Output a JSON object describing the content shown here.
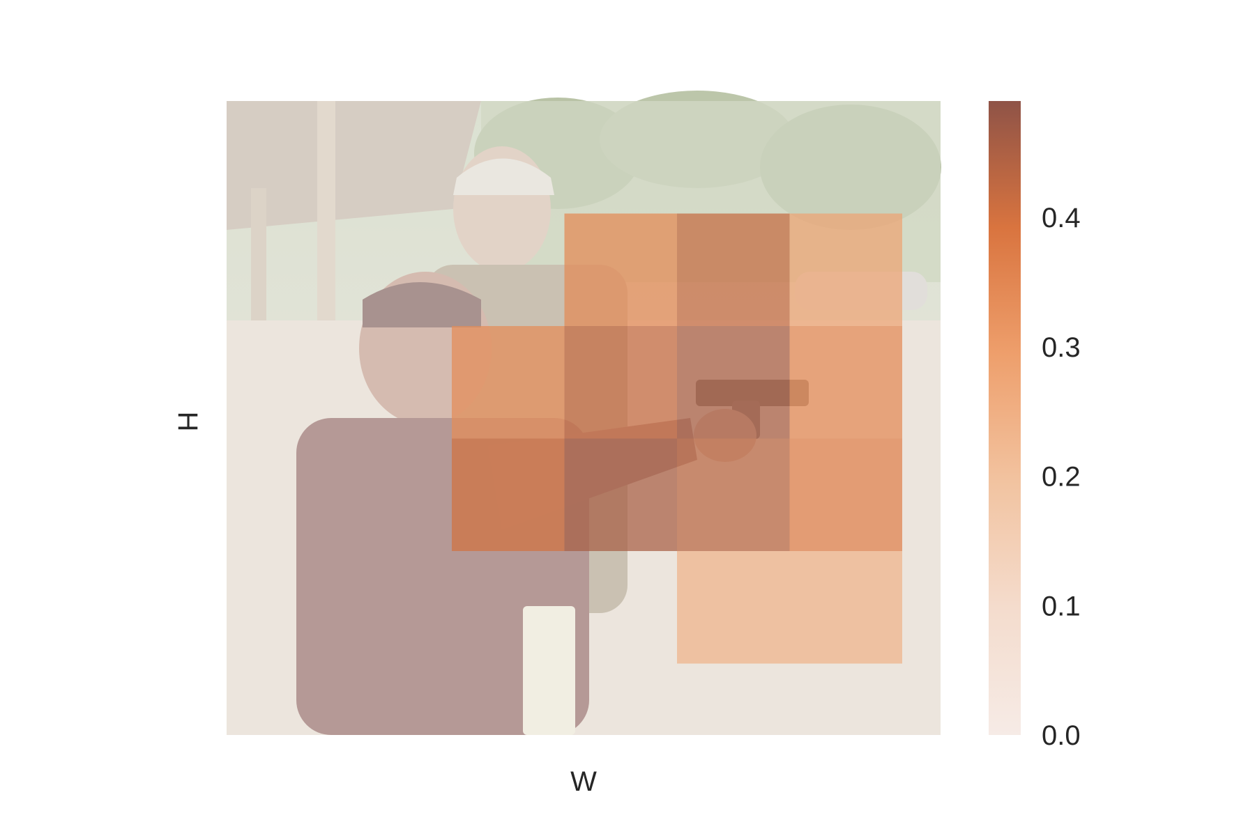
{
  "chart_data": {
    "type": "heatmap",
    "title": "",
    "xlabel": "W",
    "ylabel": "H",
    "background": "photo: woman aiming a pistol at an outdoor shooting range, soldier in cap instructing behind her",
    "grid_shape": [
      6,
      6
    ],
    "cells": [
      {
        "row": 1,
        "col": 3,
        "value": 0.3
      },
      {
        "row": 1,
        "col": 4,
        "value": 0.4
      },
      {
        "row": 1,
        "col": 5,
        "value": 0.22
      },
      {
        "row": 2,
        "col": 2,
        "value": 0.29
      },
      {
        "row": 2,
        "col": 3,
        "value": 0.4
      },
      {
        "row": 2,
        "col": 4,
        "value": 0.45
      },
      {
        "row": 2,
        "col": 5,
        "value": 0.3
      },
      {
        "row": 3,
        "col": 2,
        "value": 0.38
      },
      {
        "row": 3,
        "col": 3,
        "value": 0.45
      },
      {
        "row": 3,
        "col": 4,
        "value": 0.42
      },
      {
        "row": 3,
        "col": 5,
        "value": 0.33
      },
      {
        "row": 4,
        "col": 4,
        "value": 0.18
      },
      {
        "row": 4,
        "col": 5,
        "value": 0.18
      }
    ],
    "colorbar": {
      "min": 0.0,
      "max": 0.49,
      "ticks": [
        "0.0",
        "0.1",
        "0.2",
        "0.3",
        "0.4"
      ],
      "tick_values": [
        0.0,
        0.1,
        0.2,
        0.3,
        0.4
      ],
      "colors": [
        "#f6ebe6",
        "#f2c9a8",
        "#ec9a66",
        "#d9743f",
        "#8f5347"
      ]
    },
    "grid": false,
    "legend": "colorbar-right"
  }
}
